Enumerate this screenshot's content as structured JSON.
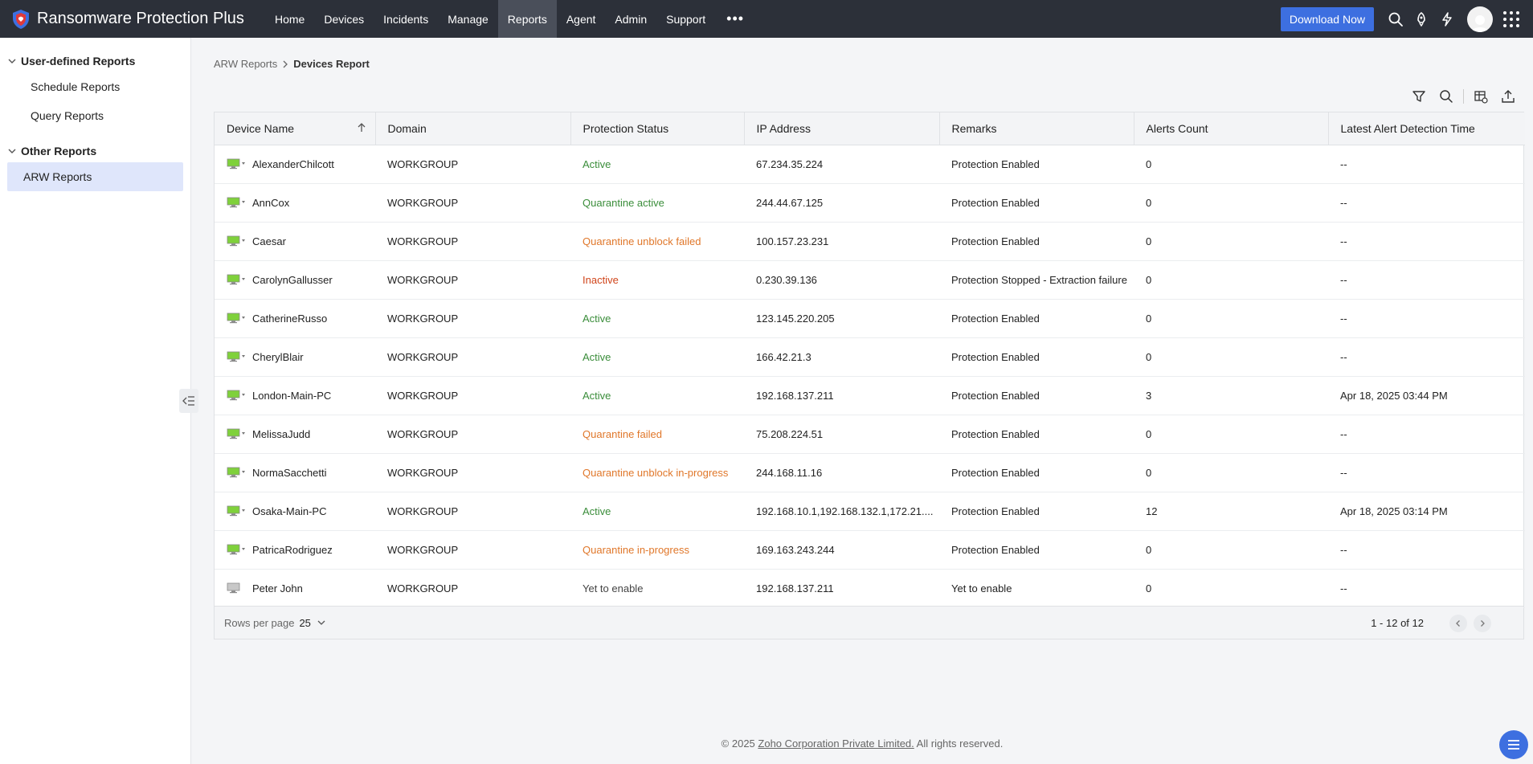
{
  "app": {
    "title": "Ransomware Protection Plus"
  },
  "nav": {
    "items": [
      "Home",
      "Devices",
      "Incidents",
      "Manage",
      "Reports",
      "Agent",
      "Admin",
      "Support"
    ],
    "active": "Reports",
    "more": "•••"
  },
  "header": {
    "download_label": "Download Now"
  },
  "sidebar": {
    "groups": [
      {
        "label": "User-defined Reports",
        "items": [
          "Schedule Reports",
          "Query Reports"
        ]
      },
      {
        "label": "Other Reports",
        "items": [
          "ARW Reports"
        ]
      }
    ],
    "selected": "ARW Reports"
  },
  "breadcrumb": {
    "parent": "ARW Reports",
    "current": "Devices Report"
  },
  "table": {
    "columns": [
      "Device Name",
      "Domain",
      "Protection Status",
      "IP Address",
      "Remarks",
      "Alerts Count",
      "Latest Alert Detection Time"
    ],
    "rows": [
      {
        "device": "AlexanderChilcott",
        "domain": "WORKGROUP",
        "status": "Active",
        "status_kind": "green",
        "ip": "67.234.35.224",
        "remarks": "Protection Enabled",
        "alerts": "0",
        "latest": "--",
        "icon": "green"
      },
      {
        "device": "AnnCox",
        "domain": "WORKGROUP",
        "status": "Quarantine active",
        "status_kind": "green",
        "ip": "244.44.67.125",
        "remarks": "Protection Enabled",
        "alerts": "0",
        "latest": "--",
        "icon": "green"
      },
      {
        "device": "Caesar",
        "domain": "WORKGROUP",
        "status": "Quarantine unblock failed",
        "status_kind": "orange",
        "ip": "100.157.23.231",
        "remarks": "Protection Enabled",
        "alerts": "0",
        "latest": "--",
        "icon": "green"
      },
      {
        "device": "CarolynGallusser",
        "domain": "WORKGROUP",
        "status": "Inactive",
        "status_kind": "red",
        "ip": "0.230.39.136",
        "remarks": "Protection Stopped - Extraction failure",
        "alerts": "0",
        "latest": "--",
        "icon": "green"
      },
      {
        "device": "CatherineRusso",
        "domain": "WORKGROUP",
        "status": "Active",
        "status_kind": "green",
        "ip": "123.145.220.205",
        "remarks": "Protection Enabled",
        "alerts": "0",
        "latest": "--",
        "icon": "green"
      },
      {
        "device": "CherylBlair",
        "domain": "WORKGROUP",
        "status": "Active",
        "status_kind": "green",
        "ip": "166.42.21.3",
        "remarks": "Protection Enabled",
        "alerts": "0",
        "latest": "--",
        "icon": "green"
      },
      {
        "device": "London-Main-PC",
        "domain": "WORKGROUP",
        "status": "Active",
        "status_kind": "green",
        "ip": "192.168.137.211",
        "remarks": "Protection Enabled",
        "alerts": "3",
        "latest": "Apr 18, 2025 03:44 PM",
        "icon": "green"
      },
      {
        "device": "MelissaJudd",
        "domain": "WORKGROUP",
        "status": "Quarantine failed",
        "status_kind": "orange",
        "ip": "75.208.224.51",
        "remarks": "Protection Enabled",
        "alerts": "0",
        "latest": "--",
        "icon": "green"
      },
      {
        "device": "NormaSacchetti",
        "domain": "WORKGROUP",
        "status": "Quarantine unblock in-progress",
        "status_kind": "orange",
        "ip": "244.168.11.16",
        "remarks": "Protection Enabled",
        "alerts": "0",
        "latest": "--",
        "icon": "green"
      },
      {
        "device": "Osaka-Main-PC",
        "domain": "WORKGROUP",
        "status": "Active",
        "status_kind": "green",
        "ip": "192.168.10.1,192.168.132.1,172.21....",
        "remarks": "Protection Enabled",
        "alerts": "12",
        "latest": "Apr 18, 2025 03:14 PM",
        "icon": "green"
      },
      {
        "device": "PatricaRodriguez",
        "domain": "WORKGROUP",
        "status": "Quarantine in-progress",
        "status_kind": "orange",
        "ip": "169.163.243.244",
        "remarks": "Protection Enabled",
        "alerts": "0",
        "latest": "--",
        "icon": "green"
      },
      {
        "device": "Peter John",
        "domain": "WORKGROUP",
        "status": "Yet to enable",
        "status_kind": "gray",
        "ip": "192.168.137.211",
        "remarks": "Yet to enable",
        "alerts": "0",
        "latest": "--",
        "icon": "gray"
      }
    ]
  },
  "footer": {
    "rows_per_page_label": "Rows per page",
    "rows_per_page_value": "25",
    "range_text": "1 - 12 of 12"
  },
  "copyright": {
    "prefix": "© 2025 ",
    "company": "Zoho Corporation Private Limited.",
    "suffix": " All rights reserved."
  },
  "colors": {
    "topbar": "#2c3039",
    "accent": "#3d6fe0",
    "status_green": "#3a8d3a",
    "status_orange": "#e0772a",
    "status_red": "#d0451b"
  },
  "icons": [
    "shield-logo-icon",
    "search-icon",
    "rocket-icon",
    "lightning-icon",
    "avatar",
    "apps-grid-icon",
    "filter-icon",
    "table-settings-icon",
    "export-icon",
    "sort-up-icon",
    "monitor-icon",
    "chevron-down-icon",
    "chevron-left-icon",
    "chevron-right-icon",
    "collapse-sidebar-icon",
    "help-menu-icon"
  ]
}
